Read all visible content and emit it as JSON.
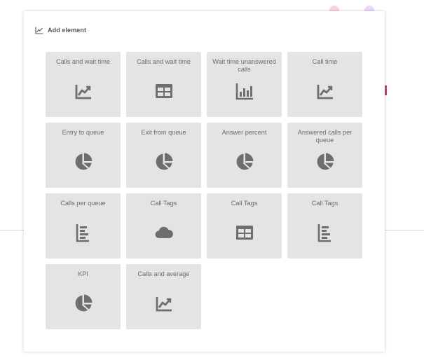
{
  "modal": {
    "title": "Add element",
    "title_icon": "line-chart-icon"
  },
  "tiles": [
    {
      "label": "Calls and wait time",
      "icon": "line-chart-icon"
    },
    {
      "label": "Calls and wait time",
      "icon": "table-icon"
    },
    {
      "label": "Wait time unanswered calls",
      "icon": "bar-chart-icon"
    },
    {
      "label": "Call time",
      "icon": "line-chart-icon"
    },
    {
      "label": "Entry to queue",
      "icon": "pie-chart-icon"
    },
    {
      "label": "Exit from queue",
      "icon": "pie-chart-icon"
    },
    {
      "label": "Answer percent",
      "icon": "pie-chart-icon"
    },
    {
      "label": "Answered calls per queue",
      "icon": "pie-chart-icon"
    },
    {
      "label": "Calls per queue",
      "icon": "horizontal-bar-chart-icon"
    },
    {
      "label": "Call Tags",
      "icon": "cloud-icon"
    },
    {
      "label": "Call Tags",
      "icon": "table-icon"
    },
    {
      "label": "Call Tags",
      "icon": "horizontal-bar-chart-icon"
    },
    {
      "label": "KPI",
      "icon": "pie-chart-icon"
    },
    {
      "label": "Calls and average",
      "icon": "line-chart-icon"
    }
  ],
  "colors": {
    "tile_background": "#e4e4e4",
    "tile_text": "#6b6b6b",
    "icon": "#6e6e6e",
    "accent": "#e3336a"
  }
}
